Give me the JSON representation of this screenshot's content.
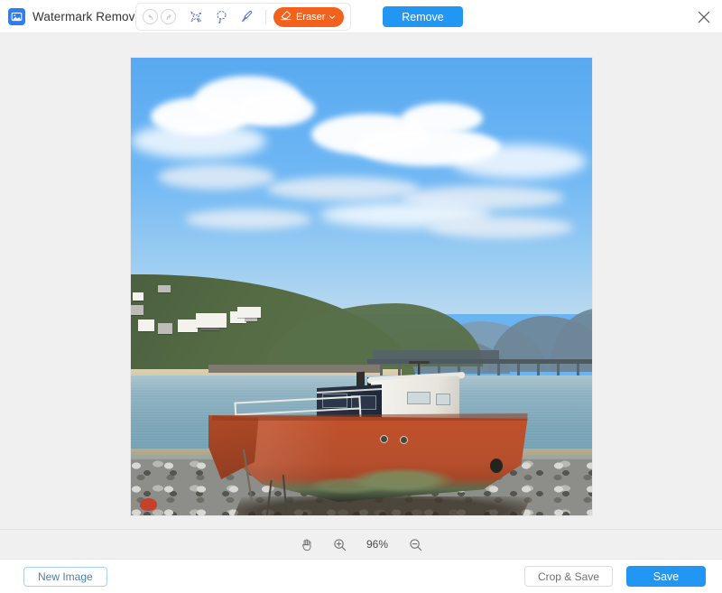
{
  "window": {
    "title": "Watermark Remover",
    "logo_icon": "image-photo-icon",
    "close_icon": "close-icon"
  },
  "toolbar": {
    "undo_icon": "undo-arrow-icon",
    "redo_icon": "redo-arrow-icon",
    "tools": [
      {
        "name": "polygonal-lasso-tool",
        "icon": "polygon-lasso-icon"
      },
      {
        "name": "lasso-select-tool",
        "icon": "lasso-icon"
      },
      {
        "name": "brush-tool",
        "icon": "brush-icon"
      }
    ],
    "eraser": {
      "label": "Eraser",
      "icon": "eraser-icon",
      "chevron": "chevron-down-icon",
      "color": "#f2621d"
    },
    "remove_label": "Remove",
    "remove_color": "#2196f3"
  },
  "canvas": {
    "background": "#f0f0f0",
    "image_alt": "Beached red fishing boat on sand at an estuary with a railway viaduct and hillside town"
  },
  "zoombar": {
    "pan_icon": "hand-pan-icon",
    "zoom_in_icon": "zoom-in-icon",
    "zoom_out_icon": "zoom-out-icon",
    "zoom_level": "96%"
  },
  "footer": {
    "new_image_label": "New Image",
    "crop_save_label": "Crop & Save",
    "save_label": "Save",
    "save_color": "#2196f3"
  }
}
